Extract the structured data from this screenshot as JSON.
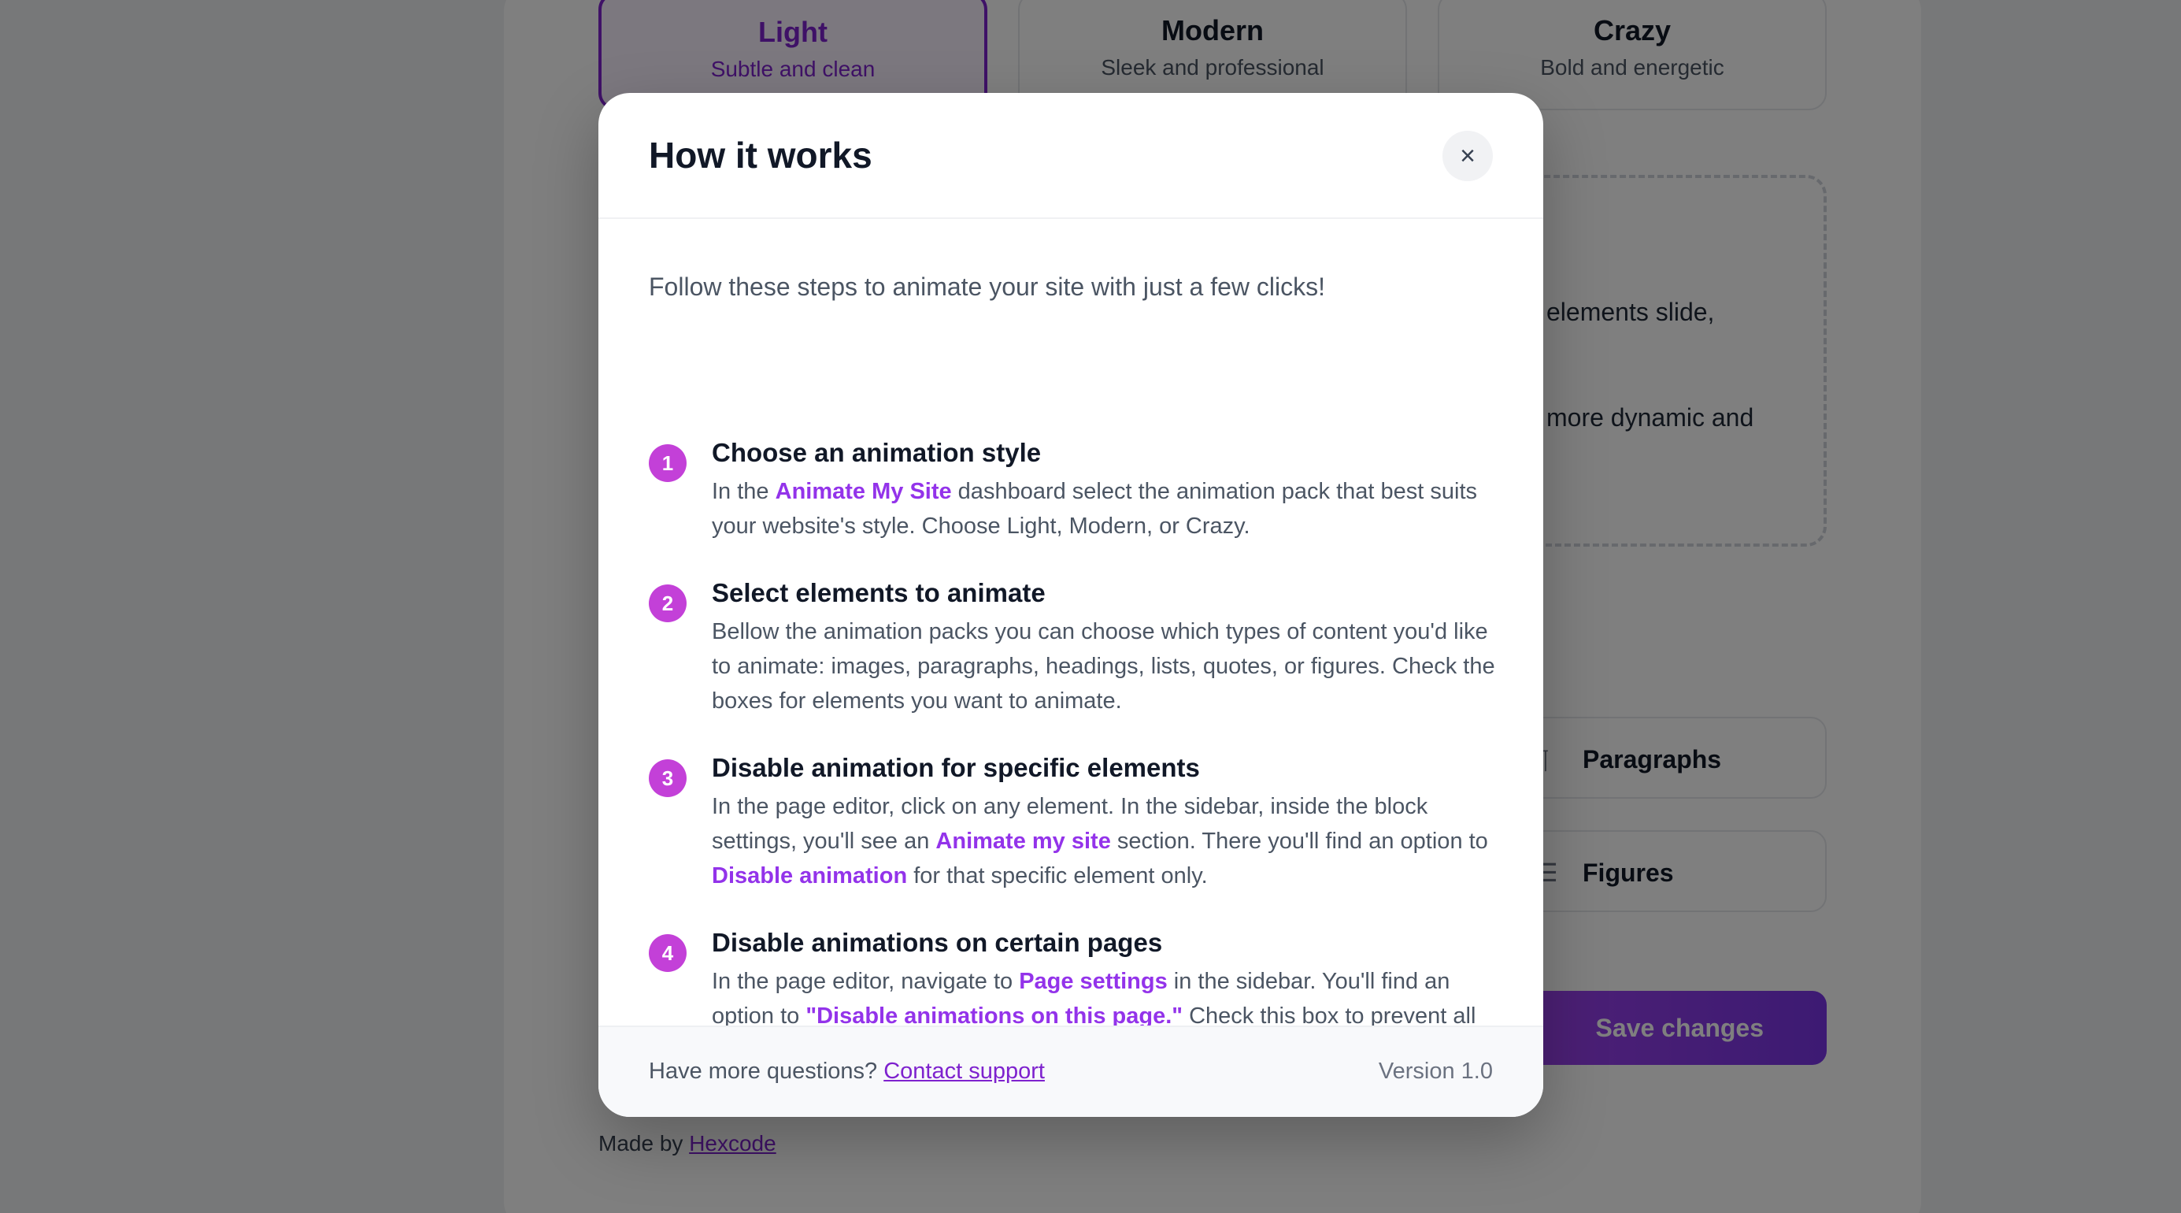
{
  "background": {
    "packs": [
      {
        "title": "Light",
        "subtitle": "Subtle and clean"
      },
      {
        "title": "Modern",
        "subtitle": "Sleek and professional"
      },
      {
        "title": "Crazy",
        "subtitle": "Bold and energetic"
      }
    ],
    "preview": {
      "line1": "elements slide,",
      "line2": "more dynamic and"
    },
    "options": {
      "paragraphs": "Paragraphs",
      "figures": "Figures"
    },
    "save_label": "Save changes",
    "credit": {
      "prefix": "Made by",
      "link": "Hexcode"
    }
  },
  "modal": {
    "title": "How it works",
    "close_icon": "×",
    "intro": "Follow these steps to animate your site with just a few clicks!",
    "steps": [
      {
        "number": "1",
        "title": "Choose an animation style",
        "body": {
          "t1": "In the ",
          "h1": "Animate My Site",
          "t2": " dashboard select the animation pack that best suits your website's style. Choose Light, Modern, or Crazy."
        }
      },
      {
        "number": "2",
        "title": "Select elements to animate",
        "body": {
          "t1": "Bellow the animation packs you can choose which types of content you'd like to animate: images, paragraphs, headings, lists, quotes, or figures. Check the boxes for elements you want to animate."
        }
      },
      {
        "number": "3",
        "title": "Disable animation for specific elements",
        "body": {
          "t1": "In the page editor, click on any element. In the sidebar, inside the block settings, you'll see an ",
          "h1": "Animate my site",
          "t2": " section. There you'll find an option to ",
          "h2": "Disable animation",
          "t3": " for that specific element only."
        }
      },
      {
        "number": "4",
        "title": "Disable animations on certain pages",
        "body": {
          "t1": "In the page editor, navigate to ",
          "h1": "Page settings",
          "t2": " in the sidebar. You'll find an option to ",
          "h2": "\"Disable animations on this page.\"",
          "t3": " Check this box to prevent all animations on that specific page."
        }
      }
    ],
    "footer": {
      "question": "Have more questions?",
      "link": "Contact support",
      "version": "Version 1.0"
    }
  }
}
